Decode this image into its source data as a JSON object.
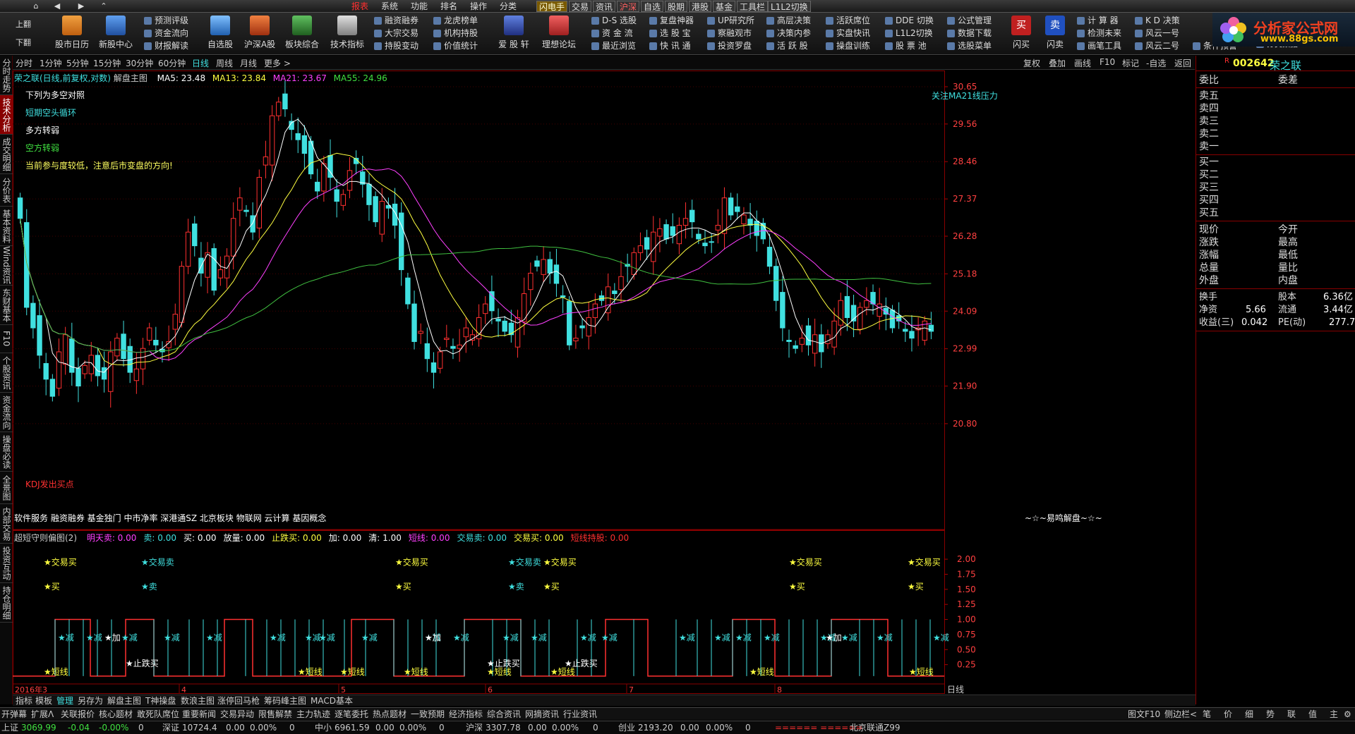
{
  "menubar": {
    "items": [
      "系统",
      "功能",
      "排名",
      "操作",
      "分类"
    ],
    "tabs": [
      "闪电手",
      "交易",
      "资讯",
      "沪深",
      "自选",
      "股期",
      "港股",
      "基金",
      "工具栏",
      "L1L2切换"
    ],
    "red_label": "报表"
  },
  "toolbar": {
    "page_up": "上翻",
    "page_down": "下翻",
    "big": [
      "股市日历",
      "新股中心",
      "自选股",
      "沪深A股",
      "板块综合",
      "技术指标",
      "爱 股 轩",
      "理想论坛"
    ],
    "col1": [
      "预测评级",
      "资金流向",
      "财报解读"
    ],
    "col2": [
      "融资融券",
      "大宗交易",
      "持股变动"
    ],
    "col3": [
      "龙虎榜单",
      "机构持股",
      "价值统计"
    ],
    "col4": [
      "D-S 选股",
      "资 金 流",
      "最近浏览"
    ],
    "col5": [
      "复盘神器",
      "选 股 宝",
      "快 讯 通"
    ],
    "col6": [
      "UP研究所",
      "察融观市",
      "投资罗盘"
    ],
    "col7": [
      "高层决策",
      "决策内参",
      "活 跃 股"
    ],
    "col8": [
      "活跃席位",
      "实盘快讯",
      "操盘训练"
    ],
    "col9": [
      "DDE 切换",
      "L1L2切换",
      "股 票 池"
    ],
    "col10": [
      "公式管理",
      "数据下载",
      "选股菜单"
    ],
    "buy_label": "闪买",
    "sell_label": "闪卖",
    "col11": [
      "计 算 器",
      "检测未来",
      "画笔工具"
    ],
    "col12": [
      "K D 决策",
      "风云一号",
      "风云二号"
    ],
    "col13": [
      "",
      "",
      "条件预警"
    ],
    "col14": [
      "分类数据"
    ]
  },
  "logo": {
    "title": "分析家公式网",
    "url": "www.88gs.com"
  },
  "period": {
    "items": [
      "分时",
      "1分钟",
      "5分钟",
      "15分钟",
      "30分钟",
      "60分钟",
      "日线",
      "周线",
      "月线",
      "更多 >"
    ],
    "right": [
      "复权",
      "叠加",
      "画线",
      "F10",
      "标记",
      "-自选",
      "返回"
    ]
  },
  "left_tabs": [
    "分时走势",
    "技术分析",
    "成交明细",
    "分价表",
    "基本资料",
    "Wind资讯",
    "东财基本",
    "F10",
    "个股资讯",
    "资金流向",
    "操盘必读",
    "全景图",
    "内部交易",
    "投资互动",
    "持仓明细"
  ],
  "main_chart": {
    "title_parts": {
      "name": "荣之联(日线,前复权,对数)",
      "suffix": "解盘主图",
      "ma5": "MA5: 23.48",
      "ma13": "MA13: 23.84",
      "ma21": "MA21: 23.67",
      "ma55": "MA55: 24.96"
    },
    "notes": [
      "下列为多空对照",
      "短期空头循环",
      "多方转弱",
      "空方转弱",
      "当前参与度较低，注意后市变盘的方向!"
    ],
    "note_right": "关注MA21线压力",
    "kdj_label": "KDJ发出买点",
    "concepts": "软件服务 融资融券 基金独门 中市净率 深港通SZ 北京板块 物联网 云计算 基因概念",
    "brand": "~☆~易鸣解盘~☆~",
    "y_ticks": [
      "30.65",
      "29.56",
      "28.46",
      "27.37",
      "26.28",
      "25.18",
      "24.09",
      "22.99",
      "21.90",
      "20.80"
    ]
  },
  "chart_data": [
    {
      "type": "candlestick",
      "title": "荣之联(日线,前复权,对数)",
      "y_range": [
        20.2,
        31.0
      ],
      "series": [
        {
          "name": "MA5",
          "value": 23.48
        },
        {
          "name": "MA13",
          "value": 23.84
        },
        {
          "name": "MA21",
          "value": 23.67
        },
        {
          "name": "MA55",
          "value": 24.96
        }
      ],
      "x_labels": [
        "2016年3",
        "4",
        "5",
        "6",
        "7",
        "8"
      ],
      "y_ticks": [
        30.65,
        29.56,
        28.46,
        27.37,
        26.28,
        25.18,
        24.09,
        22.99,
        21.9,
        20.8
      ],
      "close": [
        26.8,
        24.2,
        23.6,
        22.8,
        22.1,
        21.6,
        22.9,
        23.4,
        22.3,
        21.9,
        22.5,
        22.8,
        22.2,
        22.1,
        22.9,
        23.3,
        22.7,
        22.3,
        22.4,
        23.0,
        23.6,
        23.1,
        22.9,
        23.2,
        24.0,
        25.4,
        26.4,
        26.0,
        25.2,
        25.8,
        24.7,
        25.3,
        25.7,
        26.8,
        27.4,
        27.0,
        26.4,
        28.0,
        28.6,
        29.8,
        30.2,
        30.0,
        29.4,
        29.1,
        28.7,
        28.1,
        27.6,
        28.4,
        28.0,
        27.3,
        27.5,
        28.2,
        28.4,
        27.8,
        27.2,
        26.7,
        27.3,
        27.1,
        26.6,
        25.3,
        24.3,
        23.2,
        23.5,
        22.7,
        22.3,
        22.9,
        23.3,
        23.0,
        23.1,
        23.6,
        23.4,
        23.9,
        24.3,
        24.1,
        23.8,
        23.5,
        23.4,
        23.9,
        24.6,
        25.2,
        25.4,
        25.6,
        25.2,
        24.9,
        24.5,
        23.1,
        23.3,
        23.6,
        23.9,
        24.3,
        24.4,
        24.8,
        24.6,
        25.1,
        25.4,
        25.8,
        26.0,
        25.9,
        26.4,
        26.5,
        26.2,
        26.3,
        26.6,
        26.8,
        26.7,
        26.2,
        26.0,
        26.1,
        26.6,
        27.4,
        26.9,
        27.0,
        26.9,
        26.6,
        26.3,
        26.2,
        25.4,
        24.4,
        23.6,
        23.2,
        23.0,
        23.3,
        23.1,
        23.4,
        22.9,
        23.4,
        23.8,
        24.4,
        23.9,
        23.8,
        24.2,
        24.4,
        24.3,
        24.3,
        24.0,
        23.6,
        23.8,
        23.5,
        23.3,
        23.6,
        23.8,
        23.5
      ]
    },
    {
      "type": "line",
      "title": "超短守则偏图(2)",
      "y_range": [
        0,
        2.2
      ],
      "y_ticks": [
        2.0,
        1.75,
        1.5,
        1.25,
        1.0,
        0.75,
        0.5,
        0.25
      ],
      "legend": [
        "明天卖: 0.00",
        "卖: 0.00",
        "买: 0.00",
        "放量: 0.00",
        "止跌买: 0.00",
        "加: 0.00",
        "清: 1.00",
        "短线: 0.00",
        "交易卖: 0.00",
        "交易买: 0.00",
        "短线持股: 0.00"
      ],
      "markers": [
        "交易买",
        "买",
        "交易卖",
        "卖",
        "减",
        "加",
        "止跌买",
        "短线"
      ]
    }
  ],
  "sub_chart": {
    "title": "超短守则偏图(2)",
    "legend": [
      {
        "t": "明天卖: 0.00",
        "c": "#ff40ff"
      },
      {
        "t": "卖: 0.00",
        "c": "#40e0e0"
      },
      {
        "t": "买: 0.00",
        "c": "#ffffff"
      },
      {
        "t": "放量: 0.00",
        "c": "#ffffff"
      },
      {
        "t": "止跌买: 0.00",
        "c": "#ffff40"
      },
      {
        "t": "加: 0.00",
        "c": "#ffffff"
      },
      {
        "t": "清: 1.00",
        "c": "#ffffff"
      },
      {
        "t": "短线: 0.00",
        "c": "#ff40ff"
      },
      {
        "t": "交易卖: 0.00",
        "c": "#40e0e0"
      },
      {
        "t": "交易买: 0.00",
        "c": "#ffff40"
      },
      {
        "t": "短线持股: 0.00",
        "c": "#ff3030"
      }
    ],
    "y_ticks": [
      "2.00",
      "1.75",
      "1.50",
      "1.25",
      "1.00",
      "0.75",
      "0.50",
      "0.25"
    ],
    "x_labels": [
      "2016年3",
      "4",
      "5",
      "6",
      "7",
      "8"
    ],
    "period_label": "日线"
  },
  "bottom_tabs": [
    "指标",
    "模板",
    "管理",
    "另存为",
    "解盘主图",
    "T神操盘",
    "数浪主图",
    "涨停回马枪",
    "筹码峰主图",
    "MACD基本"
  ],
  "bottom2": [
    "开弹幕",
    "扩展Λ",
    "关联报价",
    "核心题材",
    "敢死队席位",
    "重要新闻",
    "交易异动",
    "限售解禁",
    "主力轨迹",
    "逐笔委托",
    "热点题材",
    "一致预期",
    "经济指标",
    "综合资讯",
    "网摘资讯",
    "行业资讯"
  ],
  "bottom2_right": [
    "图文F10",
    "侧边栏<",
    "笔",
    "价",
    "细",
    "势",
    "联",
    "值",
    "主",
    "⚙"
  ],
  "status": {
    "sh": "上证",
    "sh_v": "3069.99",
    "sh_c": "-0.04",
    "sh_p": "-0.00%",
    "sh_z": "0",
    "sz": "深证",
    "sz_v": "10724.4",
    "sz_c": "0.00",
    "sz_p": "0.00%",
    "sz_z": "0",
    "zx": "中小",
    "zx_v": "6961.59",
    "zx_c": "0.00",
    "zx_p": "0.00%",
    "zx_z": "0",
    "hs": "沪深",
    "hs_v": "3307.78",
    "hs_c": "0.00",
    "hs_p": "0.00%",
    "hs_z": "0",
    "cy": "创业",
    "cy_v": "2193.20",
    "cy_c": "0.00",
    "cy_p": "0.00%",
    "cy_z": "0",
    "bj": "北京联通Z99",
    "dots": "====== ======"
  },
  "right_panel": {
    "code": "002642",
    "name": "荣之联",
    "r": "R",
    "weibi": "委比",
    "weicha": "委差",
    "sells": [
      "卖五",
      "卖四",
      "卖三",
      "卖二",
      "卖一"
    ],
    "buys": [
      "买一",
      "买二",
      "买三",
      "买四",
      "买五"
    ],
    "info": [
      [
        "现价",
        "今开"
      ],
      [
        "涨跌",
        "最高"
      ],
      [
        "涨幅",
        "最低"
      ],
      [
        "总量",
        "量比"
      ],
      [
        "外盘",
        "内盘"
      ]
    ],
    "info2": [
      [
        "换手",
        "",
        "股本",
        "6.36亿"
      ],
      [
        "净资",
        "5.66",
        "流通",
        "3.44亿"
      ],
      [
        "收益(三)",
        "0.042",
        "PE(动)",
        "277.7"
      ]
    ]
  }
}
